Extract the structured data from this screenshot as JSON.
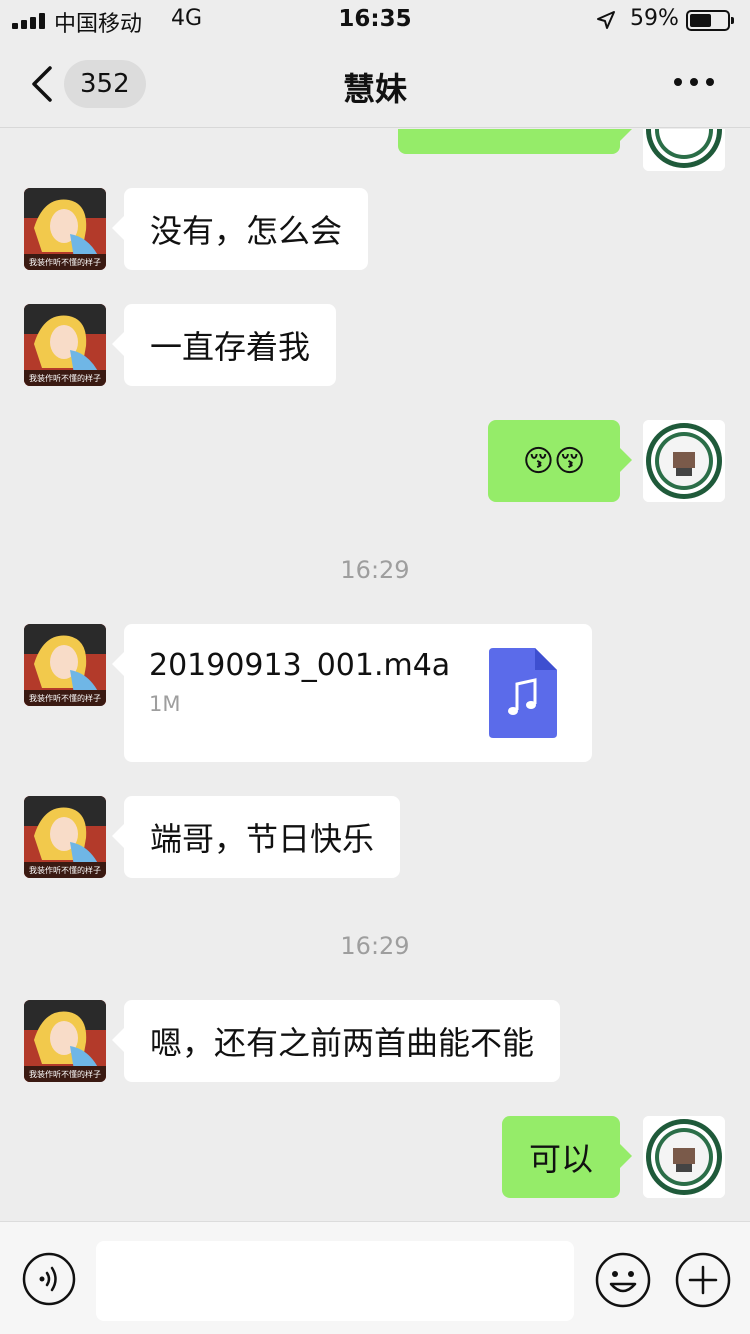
{
  "status_bar": {
    "carrier": "中国移动",
    "network": "4G",
    "time": "16:35",
    "battery_percent": "59%",
    "battery_level": 0.59
  },
  "nav": {
    "unread_count": "352",
    "title": "慧妹"
  },
  "messages": [
    {
      "side": "left",
      "text": "没有，怎么会"
    },
    {
      "side": "left",
      "text": "一直存着我"
    },
    {
      "side": "right",
      "text": "😚😚"
    },
    {
      "timestamp": "16:29"
    },
    {
      "side": "left",
      "type": "file",
      "file_name": "20190913_001.m4a",
      "file_size": "1M"
    },
    {
      "side": "left",
      "text": "端哥，节日快乐"
    },
    {
      "timestamp": "16:29"
    },
    {
      "side": "left",
      "text": "嗯，还有之前两首曲能不能"
    },
    {
      "side": "right",
      "text": "可以"
    }
  ],
  "avatar_caption": "我装作听不懂的样子",
  "colors": {
    "background": "#ededed",
    "own_bubble": "#95ec69",
    "other_bubble": "#ffffff",
    "file_icon": "#5b6bea"
  },
  "input_bar": {
    "value": "",
    "icons": [
      "voice-icon",
      "emoji-icon",
      "plus-icon"
    ]
  }
}
